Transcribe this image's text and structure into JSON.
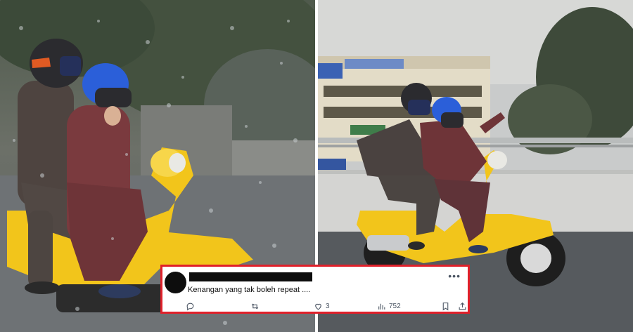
{
  "tweet": {
    "text": "Kenangan yang tak boleh repeat ....",
    "likes": "3",
    "views": "752"
  },
  "icons": {
    "more": "more-horizontal-icon",
    "reply": "reply-icon",
    "retweet": "retweet-icon",
    "like": "heart-icon",
    "views": "views-chart-icon",
    "bookmark": "bookmark-icon",
    "share": "share-icon"
  },
  "colors": {
    "card_border": "#e0202a",
    "scooter": "#f2c51b"
  }
}
